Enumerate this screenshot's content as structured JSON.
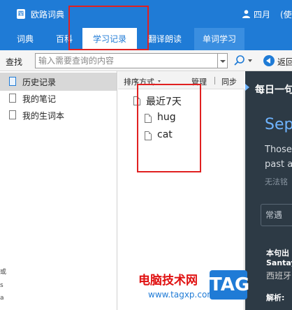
{
  "titlebar": {
    "app_logo_glyph": "四",
    "app_title": "欧路词典",
    "user_name": "四月",
    "user_extra": "(使"
  },
  "tabs": [
    {
      "label": "词典",
      "active": false
    },
    {
      "label": "百科",
      "active": false
    },
    {
      "label": "学习记录",
      "active": true
    },
    {
      "label": "翻译朗读",
      "active": false
    },
    {
      "label": "单词学习",
      "active": false
    }
  ],
  "search": {
    "label": "查找",
    "placeholder": "输入需要查询的内容",
    "back_label": "返回"
  },
  "left_nav": [
    {
      "label": "历史记录",
      "active": true
    },
    {
      "label": "我的笔记",
      "active": false
    },
    {
      "label": "我的生词本",
      "active": false
    }
  ],
  "mid": {
    "sort_label": "排序方式",
    "manage_label": "管理",
    "sync_label": "同步",
    "group_label": "最近7天",
    "words": [
      "hug",
      "cat"
    ]
  },
  "daily": {
    "title": "每日一句",
    "month": "Sep",
    "line1": "Those",
    "line2": "past a",
    "note": "无法铭",
    "button_label": "常遇",
    "source_label": "本句出",
    "source_name": "Santay",
    "source_country": "西班牙",
    "analysis_label": "解析:"
  },
  "left_edge_chars": [
    "或",
    "s",
    "a"
  ],
  "watermark": {
    "main": "电脑技术网",
    "url": "www.tagxp.com",
    "tag": "TAG"
  },
  "colors": {
    "primary": "#1f7bd6",
    "daily_bg": "#2d3a45",
    "highlight": "#e02020"
  }
}
